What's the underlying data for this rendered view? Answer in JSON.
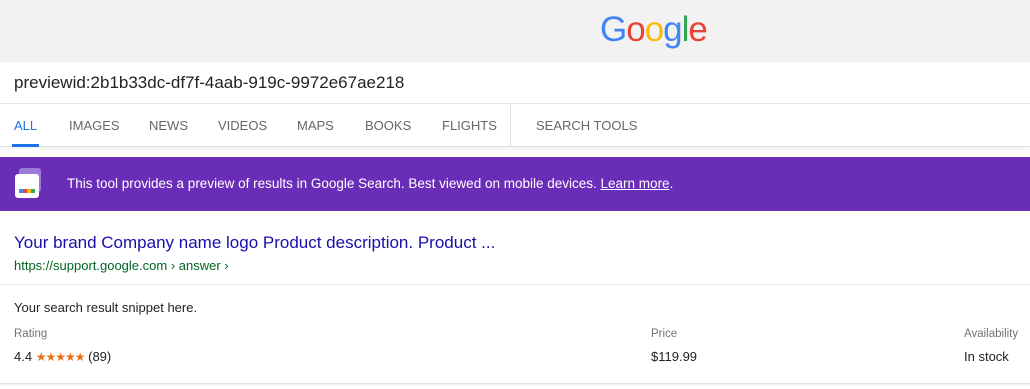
{
  "logo": {
    "letters": [
      "G",
      "o",
      "o",
      "g",
      "l",
      "e"
    ],
    "colors": [
      "#4285F4",
      "#EA4335",
      "#FBBC05",
      "#4285F4",
      "#34A853",
      "#EA4335"
    ]
  },
  "search": {
    "value": "previewid:2b1b33dc-df7f-4aab-919c-9972e67ae218"
  },
  "tabs": [
    {
      "label": "ALL",
      "active": true
    },
    {
      "label": "IMAGES",
      "active": false
    },
    {
      "label": "NEWS",
      "active": false
    },
    {
      "label": "VIDEOS",
      "active": false
    },
    {
      "label": "MAPS",
      "active": false
    },
    {
      "label": "BOOKS",
      "active": false
    },
    {
      "label": "FLIGHTS",
      "active": false
    },
    {
      "label": "SEARCH TOOLS",
      "active": false
    }
  ],
  "banner": {
    "text": "This tool provides a preview of results in Google Search. Best viewed on mobile devices.",
    "link": "Learn more",
    "suffix": ".",
    "color": "#6a2db8",
    "icon_colors": [
      "#4285F4",
      "#EA4335",
      "#FBBC05",
      "#34A853"
    ]
  },
  "result": {
    "title": "Your brand Company name logo Product description. Product ...",
    "url": "https://support.google.com › answer ›",
    "snippet": "Your search result snippet here.",
    "rating_label": "Rating",
    "rating_value": "4.4",
    "rating_stars": "★★★★★",
    "rating_count": "(89)",
    "price_label": "Price",
    "price_value": "$119.99",
    "availability_label": "Availability",
    "availability_value": "In stock"
  }
}
